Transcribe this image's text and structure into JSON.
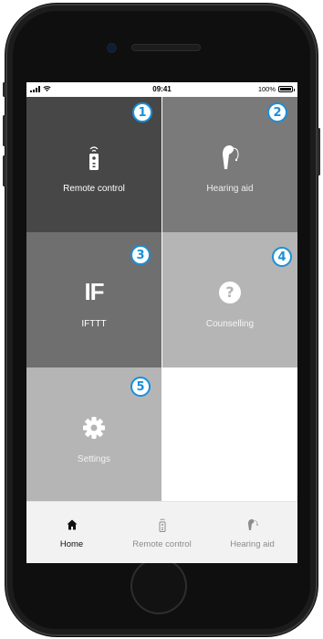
{
  "status_bar": {
    "time": "09:41",
    "battery": "100%"
  },
  "tiles": [
    {
      "label": "Remote control",
      "badge": "1",
      "icon": "remote-control-icon",
      "bg": "#474747",
      "fg": "#ffffff"
    },
    {
      "label": "Hearing aid",
      "badge": "2",
      "icon": "hearing-aid-icon",
      "bg": "#7a7a7a",
      "fg": "#eeeeee"
    },
    {
      "label": "IFTTT",
      "badge": "3",
      "icon": "ifttt-logo",
      "icon_text": "IF",
      "bg": "#6f6f6f",
      "fg": "#ffffff"
    },
    {
      "label": "Counselling",
      "badge": "4",
      "icon": "question-icon",
      "icon_text": "?",
      "bg": "#b5b5b5",
      "fg": "#eeeeee"
    },
    {
      "label": "Settings",
      "badge": "5",
      "icon": "gear-icon",
      "bg": "#b5b5b5",
      "fg": "#f2f2f2"
    }
  ],
  "tab_bar": [
    {
      "label": "Home",
      "icon": "home-icon",
      "active": true
    },
    {
      "label": "Remote control",
      "icon": "remote-control-icon",
      "active": false
    },
    {
      "label": "Hearing aid",
      "icon": "hearing-aid-icon",
      "active": false
    }
  ],
  "colors": {
    "badge_accent": "#1a8fd8",
    "active_tab": "#111111",
    "inactive_tab": "#8c8c8c"
  }
}
